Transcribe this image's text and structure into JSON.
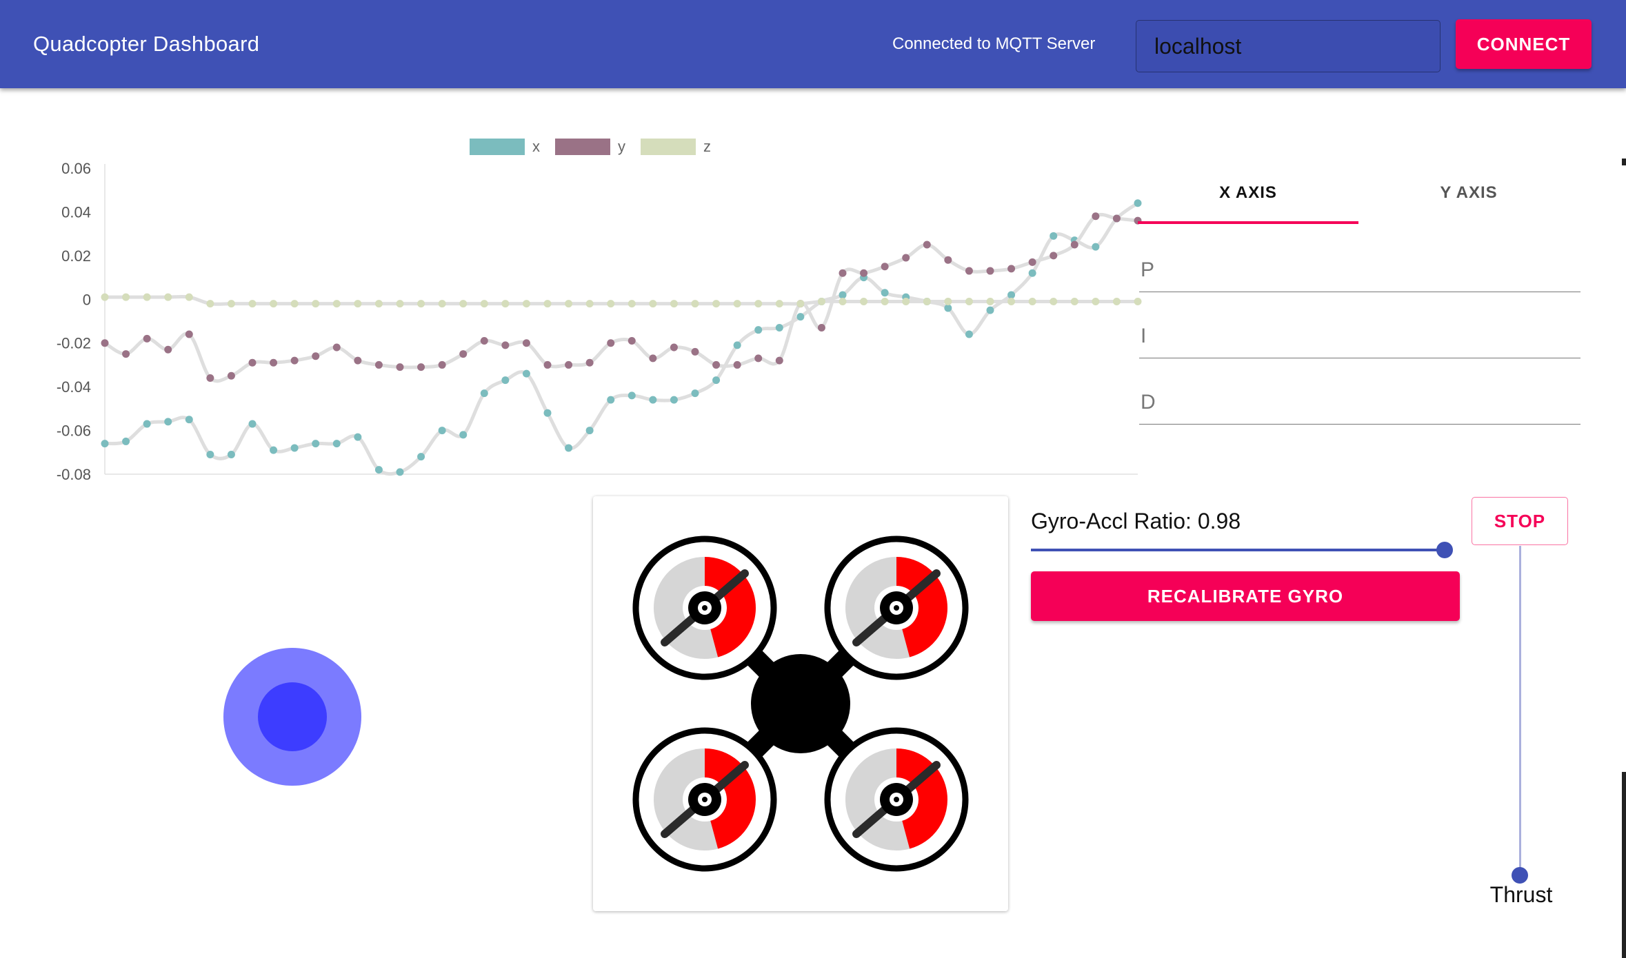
{
  "header": {
    "title": "Quadcopter Dashboard",
    "status": "Connected to MQTT Server",
    "host_value": "localhost",
    "connect_label": "CONNECT"
  },
  "chart_data": {
    "type": "line",
    "ylim": [
      -0.08,
      0.06
    ],
    "yticks": [
      "0.06",
      "0.04",
      "0.02",
      "0",
      "-0.02",
      "-0.04",
      "-0.06",
      "-0.08"
    ],
    "legend_position": "top-center",
    "grid": false,
    "series": [
      {
        "name": "x",
        "color": "#7bbcbe",
        "values": [
          -0.066,
          -0.065,
          -0.057,
          -0.056,
          -0.055,
          -0.071,
          -0.071,
          -0.057,
          -0.069,
          -0.068,
          -0.066,
          -0.066,
          -0.063,
          -0.078,
          -0.079,
          -0.072,
          -0.06,
          -0.062,
          -0.043,
          -0.037,
          -0.034,
          -0.052,
          -0.068,
          -0.06,
          -0.046,
          -0.044,
          -0.046,
          -0.046,
          -0.043,
          -0.037,
          -0.021,
          -0.014,
          -0.013,
          -0.008,
          -0.001,
          0.002,
          0.01,
          0.003,
          0.001,
          -0.001,
          -0.004,
          -0.016,
          -0.005,
          0.002,
          0.012,
          0.029,
          0.027,
          0.024,
          0.037,
          0.044
        ]
      },
      {
        "name": "y",
        "color": "#9a7286",
        "values": [
          -0.02,
          -0.025,
          -0.018,
          -0.023,
          -0.016,
          -0.036,
          -0.035,
          -0.029,
          -0.029,
          -0.028,
          -0.026,
          -0.022,
          -0.028,
          -0.03,
          -0.031,
          -0.031,
          -0.03,
          -0.025,
          -0.019,
          -0.021,
          -0.02,
          -0.03,
          -0.03,
          -0.029,
          -0.02,
          -0.019,
          -0.027,
          -0.022,
          -0.024,
          -0.03,
          -0.03,
          -0.027,
          -0.028,
          -0.002,
          -0.013,
          0.012,
          0.012,
          0.015,
          0.019,
          0.025,
          0.018,
          0.013,
          0.013,
          0.014,
          0.017,
          0.02,
          0.025,
          0.038,
          0.037,
          0.036
        ]
      },
      {
        "name": "z",
        "color": "#d5ddbb",
        "values": [
          0.001,
          0.001,
          0.001,
          0.001,
          0.001,
          -0.002,
          -0.002,
          -0.002,
          -0.002,
          -0.002,
          -0.002,
          -0.002,
          -0.002,
          -0.002,
          -0.002,
          -0.002,
          -0.002,
          -0.002,
          -0.002,
          -0.002,
          -0.002,
          -0.002,
          -0.002,
          -0.002,
          -0.002,
          -0.002,
          -0.002,
          -0.002,
          -0.002,
          -0.002,
          -0.002,
          -0.002,
          -0.002,
          -0.002,
          -0.001,
          -0.001,
          -0.001,
          -0.001,
          -0.001,
          -0.001,
          -0.001,
          -0.001,
          -0.001,
          -0.001,
          -0.001,
          -0.001,
          -0.001,
          -0.001,
          -0.001,
          -0.001
        ]
      }
    ]
  },
  "pid": {
    "tabs": [
      "X AXIS",
      "Y AXIS"
    ],
    "active_tab": "X AXIS",
    "fields": [
      {
        "label": "P"
      },
      {
        "label": "I"
      },
      {
        "label": "D"
      }
    ]
  },
  "controls": {
    "ratio_label": "Gyro-Accl Ratio: 0.98",
    "ratio_value": 0.98,
    "recalibrate_label": "RECALIBRATE GYRO",
    "stop_label": "STOP",
    "thrust_label": "Thrust",
    "thrust_value": 0
  },
  "colors": {
    "appbar": "#3f51b5",
    "accent": "#f50057",
    "joystick_outer": "#7b7bff",
    "joystick_inner": "#3d3dff",
    "motor_indicator": "#ff0000"
  },
  "icons": {
    "drone": "quadcopter-icon",
    "joystick": "joystick-icon"
  }
}
